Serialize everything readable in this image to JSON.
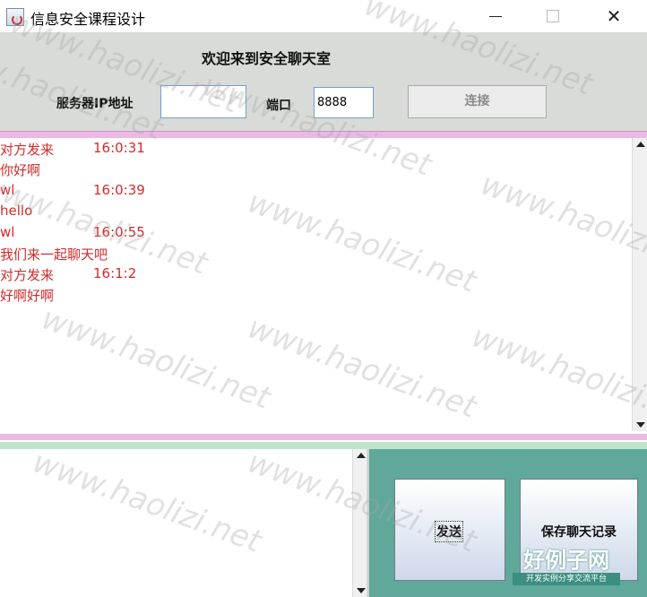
{
  "window": {
    "title": "信息安全课程设计",
    "close_glyph": "✕"
  },
  "header": {
    "welcome": "欢迎来到安全聊天室",
    "ip_label": "服务器IP地址",
    "ip_value": "",
    "port_label": "端口",
    "port_value": "8888",
    "connect_label": "连接"
  },
  "chat": {
    "messages": [
      {
        "sender": "对方发来",
        "time": "16:0:31",
        "text": "你好啊"
      },
      {
        "sender": "wl",
        "time": "16:0:39",
        "text": "hello"
      },
      {
        "sender": "wl",
        "time": "16:0:55",
        "text": "我们来一起聊天吧"
      },
      {
        "sender": "对方发来",
        "time": "16:1:2",
        "text": "好啊好啊"
      }
    ]
  },
  "buttons": {
    "send_label": "发送",
    "save_label": "保存聊天记录"
  },
  "watermark": {
    "text": "www.haolizi.net",
    "logo_main": "好例子网",
    "logo_sub": "开发实例分享交流平台"
  },
  "colors": {
    "message_text": "#d42a2a",
    "panel_bg": "#5fa89a",
    "header_bg": "#d8dbd8"
  }
}
